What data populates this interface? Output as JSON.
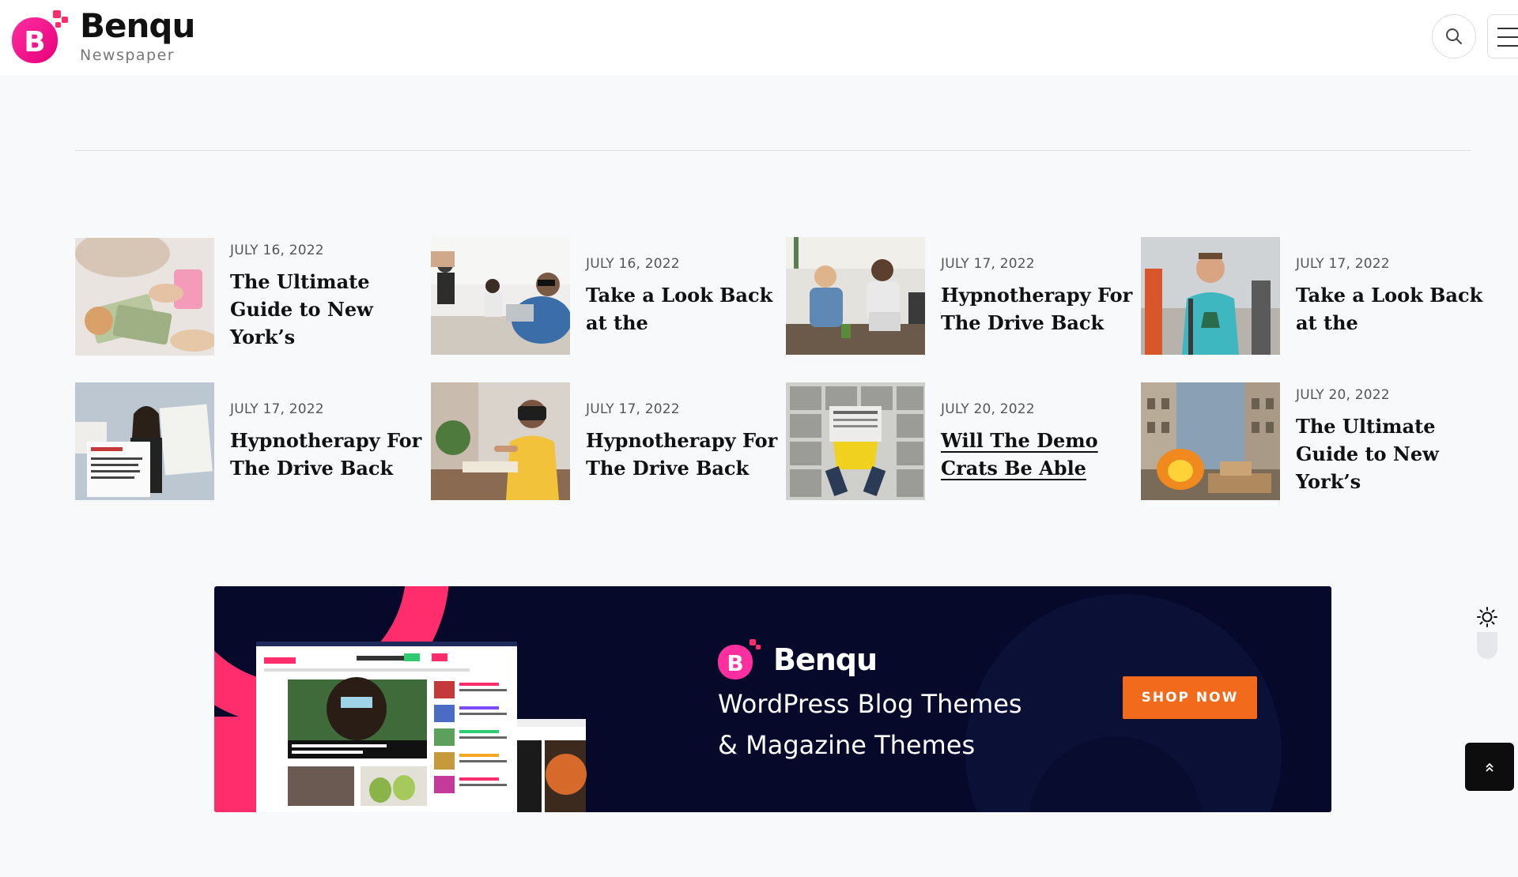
{
  "header": {
    "logo_letter": "B",
    "logo_title": "Benqu",
    "logo_subtitle": "Newspaper",
    "icons": {
      "search": "search-icon",
      "menu": "hamburger-menu-icon"
    }
  },
  "posts": [
    {
      "date": "JULY 16, 2022",
      "title": "The Ultimate Guide to New York’s",
      "thumb": "money-counting-photo"
    },
    {
      "date": "JULY 16, 2022",
      "title": "Take a Look Back at the",
      "thumb": "cafe-laptop-photo"
    },
    {
      "date": "JULY 17, 2022",
      "title": "Hypnotherapy For The Drive Back",
      "thumb": "office-meeting-photo"
    },
    {
      "date": "JULY 17, 2022",
      "title": "Take a Look Back at the",
      "thumb": "smiling-man-photo"
    },
    {
      "date": "JULY 17, 2022",
      "title": "Hypnotherapy For The Drive Back",
      "thumb": "protest-signs-photo"
    },
    {
      "date": "JULY 17, 2022",
      "title": "Hypnotherapy For The Drive Back",
      "thumb": "vr-headset-photo"
    },
    {
      "date": "JULY 20, 2022",
      "title": "Will The Demo Crats Be Able",
      "thumb": "newspaper-reader-photo",
      "underlined": true
    },
    {
      "date": "JULY 20, 2022",
      "title": "The Ultimate Guide to New York’s",
      "thumb": "street-fire-photo"
    }
  ],
  "banner": {
    "logo_letter": "B",
    "logo_title": "Benqu",
    "line1": "WordPress Blog Themes",
    "line2": "& Magazine Themes",
    "cta": "SHOP NOW"
  },
  "widgets": {
    "theme_icon": "sun-icon",
    "scroll_icon": "chevron-double-up-icon"
  },
  "colors": {
    "brand_pink": "#e8157a",
    "banner_bg": "#06092a",
    "cta_orange": "#f26a1b",
    "banner_accent": "#ff2d6b"
  }
}
